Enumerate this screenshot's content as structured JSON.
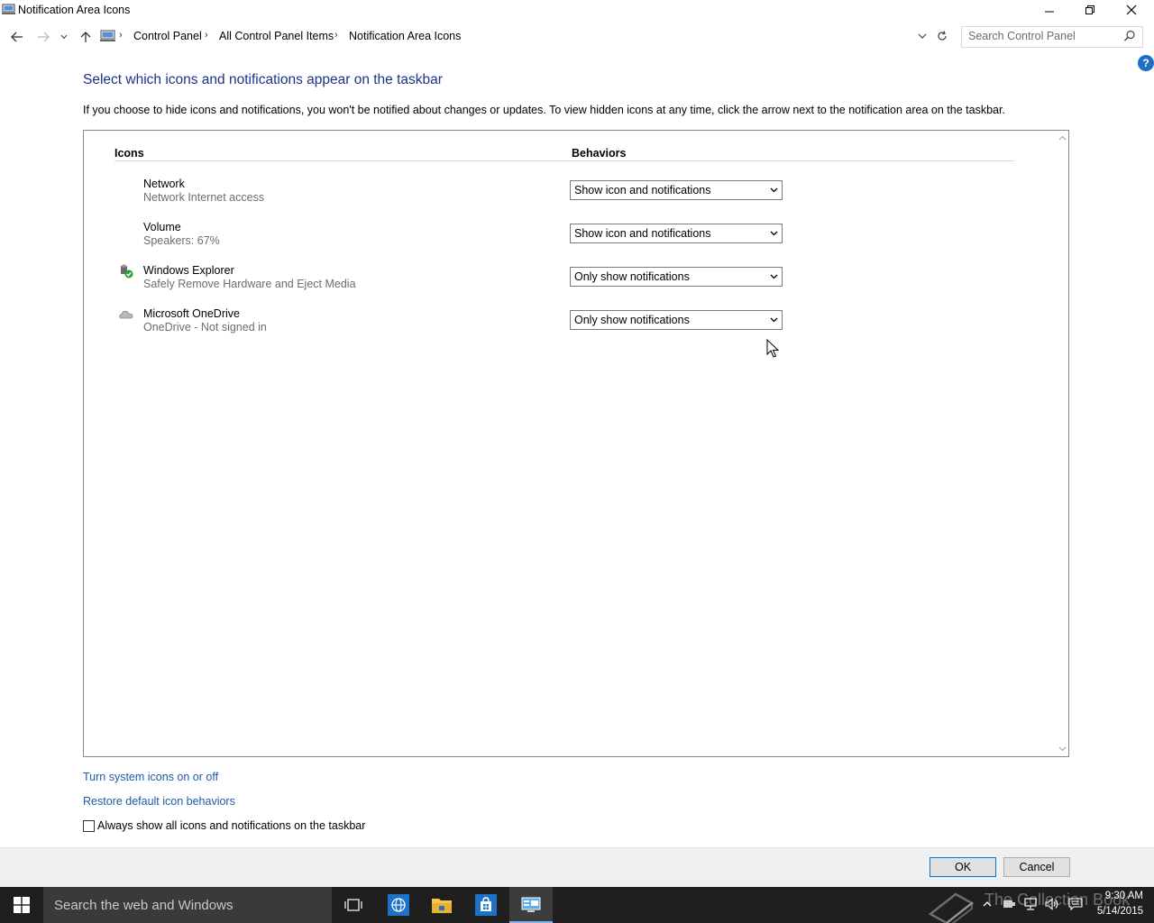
{
  "window": {
    "title": "Notification Area Icons",
    "minimize_label": "",
    "maximize_label": "",
    "close_label": ""
  },
  "address": {
    "crumbs": [
      "Control Panel",
      "All Control Panel Items",
      "Notification Area Icons"
    ],
    "separator": "›"
  },
  "search": {
    "placeholder": "Search Control Panel"
  },
  "help_label": "?",
  "heading": "Select which icons and notifications appear on the taskbar",
  "description": "If you choose to hide icons and notifications, you won't be notified about changes or updates. To view hidden icons at any time, click the arrow next to the notification area on the taskbar.",
  "table": {
    "col_icons": "Icons",
    "col_behaviors": "Behaviors",
    "rows": [
      {
        "name": "Network",
        "sub": "Network Internet access",
        "behavior": "Show icon and notifications",
        "icon": "none"
      },
      {
        "name": "Volume",
        "sub": "Speakers: 67%",
        "behavior": "Show icon and notifications",
        "icon": "none"
      },
      {
        "name": "Windows Explorer",
        "sub": "Safely Remove Hardware and Eject Media",
        "behavior": "Only show notifications",
        "icon": "usb-eject-icon"
      },
      {
        "name": "Microsoft OneDrive",
        "sub": "OneDrive - Not signed in",
        "behavior": "Only show notifications",
        "icon": "onedrive-cloud-icon"
      }
    ]
  },
  "links": {
    "system_icons": "Turn system icons on or off",
    "restore": "Restore default icon behaviors"
  },
  "always_show": {
    "label": "Always show all icons and notifications on the taskbar",
    "checked": false
  },
  "buttons": {
    "ok": "OK",
    "cancel": "Cancel"
  },
  "taskbar": {
    "search_text": "Search the web and Windows",
    "time": "9:30 AM",
    "date": "5/14/2015",
    "watermark": "The Collection Book"
  },
  "colors": {
    "heading": "#1e3287",
    "link": "#1e5aa8",
    "taskbar": "#1f1f1f",
    "accent": "#0078d7"
  }
}
